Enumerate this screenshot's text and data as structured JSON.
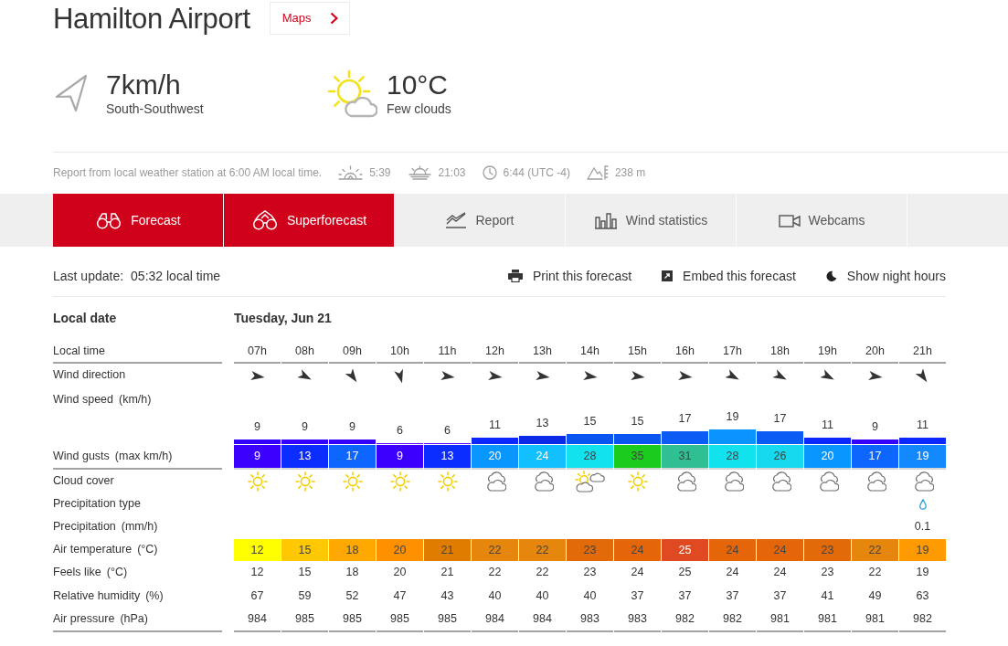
{
  "location": {
    "title": "Hamilton Airport",
    "maps_button": "Maps"
  },
  "current": {
    "wind_speed": "7km/h",
    "wind_direction": "South-Southwest",
    "temperature": "10°C",
    "conditions": "Few clouds"
  },
  "station": {
    "report": "Report from local weather station at 6:00 AM local time.",
    "sunrise": "5:39",
    "sunset": "21:03",
    "local_time": "6:44 (UTC -4)",
    "altitude": "238 m"
  },
  "tabs": [
    {
      "kind": "forecast",
      "label": "Forecast",
      "selected": true
    },
    {
      "kind": "superforecast",
      "label": "Superforecast",
      "selected": true
    },
    {
      "kind": "report",
      "label": "Report",
      "selected": false
    },
    {
      "kind": "statistics",
      "label": "Wind statistics",
      "selected": false
    },
    {
      "kind": "webcams",
      "label": "Webcams",
      "selected": false
    }
  ],
  "toolbar": {
    "last_update_label": "Last update:",
    "last_update": "05:32 local time",
    "actions": [
      {
        "kind": "print",
        "label": "Print this forecast"
      },
      {
        "kind": "embed",
        "label": "Embed this forecast"
      },
      {
        "kind": "night",
        "label": "Show night hours"
      }
    ]
  },
  "table": {
    "date_label": "Local date",
    "date": "Tuesday, Jun 21",
    "rows": [
      {
        "kind": "time",
        "label": "Local time"
      },
      {
        "kind": "direction",
        "label": "Wind direction"
      },
      {
        "kind": "speed",
        "label": "Wind speed",
        "unit": "(km/h)"
      },
      {
        "kind": "gusts",
        "label": "Wind gusts",
        "unit": "(max km/h)"
      },
      {
        "kind": "cloud",
        "label": "Cloud cover"
      },
      {
        "kind": "precip_type",
        "label": "Precipitation type"
      },
      {
        "kind": "precip",
        "label": "Precipitation",
        "unit": "(mm/h)"
      },
      {
        "kind": "temp",
        "label": "Air temperature",
        "unit": "(°C)"
      },
      {
        "kind": "feels",
        "label": "Feels like",
        "unit": "(°C)"
      },
      {
        "kind": "humidity",
        "label": "Relative humidity",
        "unit": "(%)"
      },
      {
        "kind": "pressure",
        "label": "Air pressure",
        "unit": "(hPa)"
      }
    ],
    "hours": [
      {
        "time": "07h",
        "arrow": {
          "kind": "e"
        },
        "wind": {
          "value": "9",
          "color": "#3300ff"
        },
        "gust": {
          "value": "9",
          "color": "#3c00ff"
        },
        "sky": {
          "kind": "sun"
        },
        "temp": {
          "value": "12",
          "color": "#ffff00"
        },
        "feels": "12",
        "humidity": "67",
        "pressure": "984"
      },
      {
        "time": "08h",
        "arrow": {
          "kind": "ese"
        },
        "wind": {
          "value": "9",
          "color": "#3300ff"
        },
        "gust": {
          "value": "13",
          "color": "#0b2dff"
        },
        "sky": {
          "kind": "sun"
        },
        "temp": {
          "value": "15",
          "color": "#ffc800"
        },
        "feels": "15",
        "humidity": "59",
        "pressure": "985"
      },
      {
        "time": "09h",
        "arrow": {
          "kind": "se"
        },
        "wind": {
          "value": "9",
          "color": "#3300ff"
        },
        "gust": {
          "value": "17",
          "color": "#0d66ff"
        },
        "sky": {
          "kind": "sun"
        },
        "temp": {
          "value": "18",
          "color": "#ffa800"
        },
        "feels": "18",
        "humidity": "52",
        "pressure": "985"
      },
      {
        "time": "10h",
        "arrow": {
          "kind": "sse"
        },
        "wind": {
          "value": "6",
          "color": "#5a00ff"
        },
        "gust": {
          "value": "9",
          "color": "#3c00ff"
        },
        "sky": {
          "kind": "sun"
        },
        "temp": {
          "value": "20",
          "color": "#ff9000"
        },
        "feels": "20",
        "humidity": "47",
        "pressure": "985"
      },
      {
        "time": "11h",
        "arrow": {
          "kind": "e"
        },
        "wind": {
          "value": "6",
          "color": "#5a00ff"
        },
        "gust": {
          "value": "13",
          "color": "#0b2dff"
        },
        "sky": {
          "kind": "sun"
        },
        "temp": {
          "value": "21",
          "color": "#e07d00"
        },
        "feels": "21",
        "humidity": "43",
        "pressure": "985"
      },
      {
        "time": "12h",
        "arrow": {
          "kind": "e"
        },
        "wind": {
          "value": "11",
          "color": "#0a28ff"
        },
        "gust": {
          "value": "20",
          "color": "#0a96ff"
        },
        "sky": {
          "kind": "cloud"
        },
        "temp": {
          "value": "22",
          "color": "#e6860c"
        },
        "feels": "22",
        "humidity": "40",
        "pressure": "984"
      },
      {
        "time": "13h",
        "arrow": {
          "kind": "e"
        },
        "wind": {
          "value": "13",
          "color": "#0a2ae6"
        },
        "gust": {
          "value": "24",
          "color": "#12c0ff"
        },
        "sky": {
          "kind": "cloud"
        },
        "temp": {
          "value": "22",
          "color": "#e6860c"
        },
        "feels": "22",
        "humidity": "40",
        "pressure": "984"
      },
      {
        "time": "14h",
        "arrow": {
          "kind": "e"
        },
        "wind": {
          "value": "15",
          "color": "#0a55f0"
        },
        "gust": {
          "value": "28",
          "color": "#12e2ee"
        },
        "sky": {
          "kind": "sun_cloud"
        },
        "temp": {
          "value": "23",
          "color": "#e36a08"
        },
        "feels": "23",
        "humidity": "40",
        "pressure": "983"
      },
      {
        "time": "15h",
        "arrow": {
          "kind": "e"
        },
        "wind": {
          "value": "15",
          "color": "#0a55f0"
        },
        "gust": {
          "value": "35",
          "color": "#1ccc1c"
        },
        "sky": {
          "kind": "sun"
        },
        "temp": {
          "value": "24",
          "color": "#e56608"
        },
        "feels": "24",
        "humidity": "37",
        "pressure": "983"
      },
      {
        "time": "16h",
        "arrow": {
          "kind": "e"
        },
        "wind": {
          "value": "17",
          "color": "#0a5cf5"
        },
        "gust": {
          "value": "31",
          "color": "#2fbf92"
        },
        "sky": {
          "kind": "cloud"
        },
        "temp": {
          "value": "25",
          "color": "#e04a22"
        },
        "feels": "25",
        "humidity": "37",
        "pressure": "982"
      },
      {
        "time": "17h",
        "arrow": {
          "kind": "ese"
        },
        "wind": {
          "value": "19",
          "color": "#0a94ff"
        },
        "gust": {
          "value": "28",
          "color": "#12e2ee"
        },
        "sky": {
          "kind": "cloud"
        },
        "temp": {
          "value": "24",
          "color": "#e56608"
        },
        "feels": "24",
        "humidity": "37",
        "pressure": "982"
      },
      {
        "time": "18h",
        "arrow": {
          "kind": "ese"
        },
        "wind": {
          "value": "17",
          "color": "#0a5cf5"
        },
        "gust": {
          "value": "26",
          "color": "#16d8ee"
        },
        "sky": {
          "kind": "cloud"
        },
        "temp": {
          "value": "24",
          "color": "#e56608"
        },
        "feels": "24",
        "humidity": "37",
        "pressure": "981"
      },
      {
        "time": "19h",
        "arrow": {
          "kind": "ese"
        },
        "wind": {
          "value": "11",
          "color": "#0a28ff"
        },
        "gust": {
          "value": "20",
          "color": "#0a96ff"
        },
        "sky": {
          "kind": "cloud"
        },
        "temp": {
          "value": "23",
          "color": "#e36a08"
        },
        "feels": "23",
        "humidity": "41",
        "pressure": "981"
      },
      {
        "time": "20h",
        "arrow": {
          "kind": "e"
        },
        "wind": {
          "value": "9",
          "color": "#3300ff"
        },
        "gust": {
          "value": "17",
          "color": "#0d66ff"
        },
        "sky": {
          "kind": "cloud"
        },
        "temp": {
          "value": "22",
          "color": "#e6860c"
        },
        "feels": "22",
        "humidity": "49",
        "pressure": "981"
      },
      {
        "time": "21h",
        "arrow": {
          "kind": "se"
        },
        "wind": {
          "value": "11",
          "color": "#0a28ff"
        },
        "gust": {
          "value": "19",
          "color": "#1288ff"
        },
        "sky": {
          "kind": "cloud"
        },
        "precip_type": {
          "kind": "rain"
        },
        "precip": "0.1",
        "temp": {
          "value": "19",
          "color": "#ff9a00"
        },
        "feels": "19",
        "humidity": "63",
        "pressure": "982"
      }
    ]
  }
}
